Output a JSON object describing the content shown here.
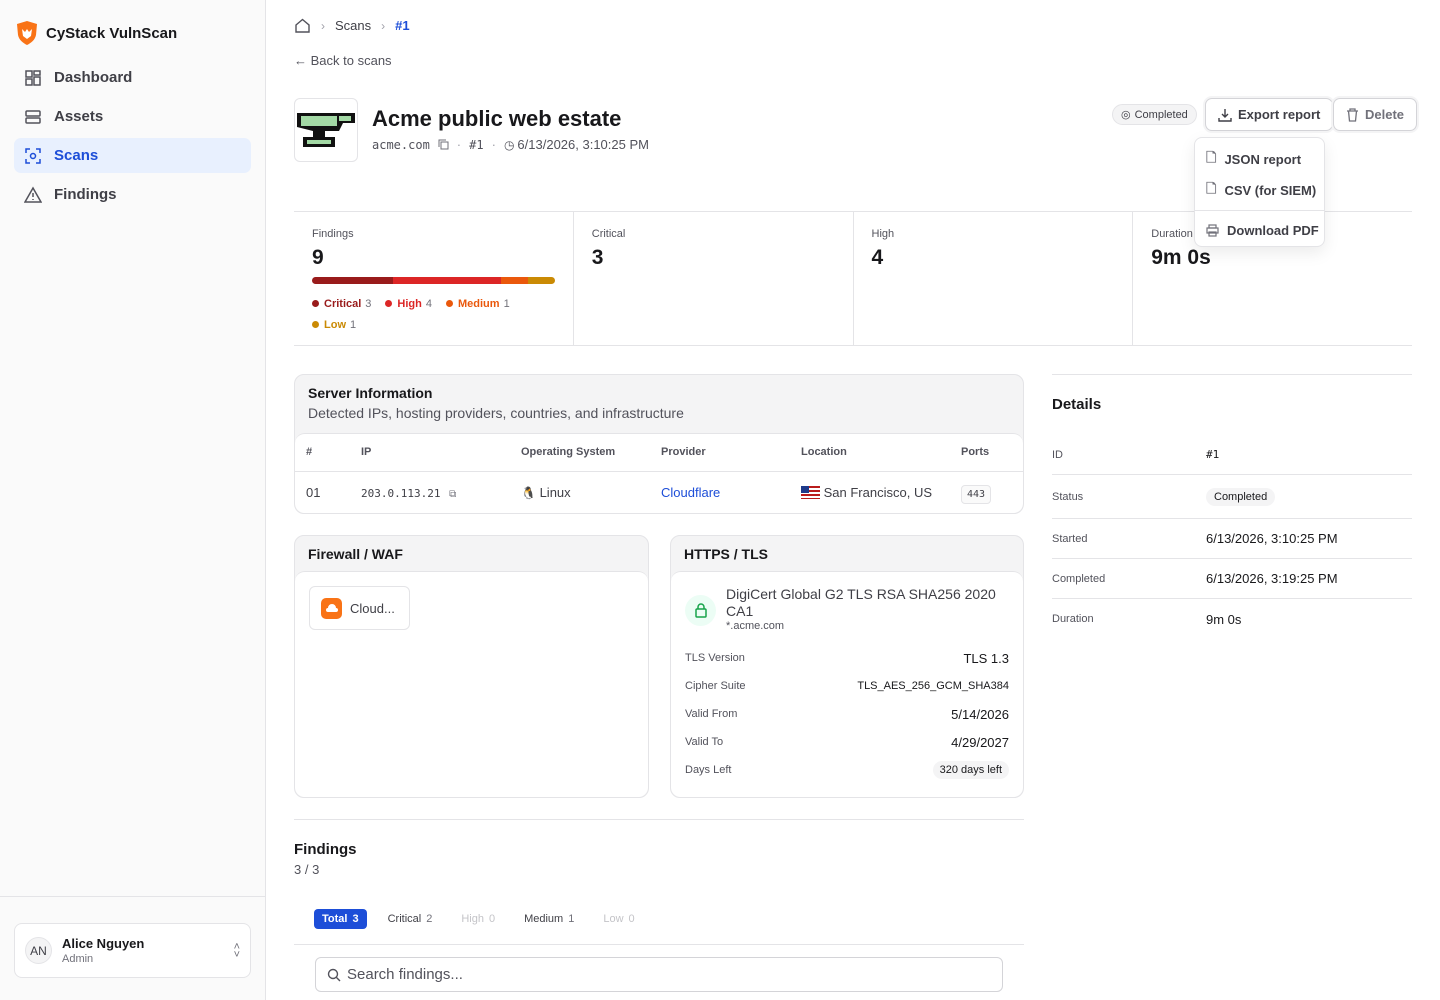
{
  "app": {
    "name": "CyStack VulnScan"
  },
  "sidebar": {
    "items": [
      {
        "label": "Dashboard",
        "icon": "dashboard-icon"
      },
      {
        "label": "Assets",
        "icon": "server-icon"
      },
      {
        "label": "Scans",
        "icon": "scan-icon",
        "active": true
      },
      {
        "label": "Findings",
        "icon": "warning-icon"
      }
    ],
    "user": {
      "initials": "AN",
      "name": "Alice Nguyen",
      "role": "Admin"
    }
  },
  "breadcrumb": {
    "items": [
      "Scans",
      "#1"
    ]
  },
  "back_label": "Back to scans",
  "scan": {
    "title": "Acme public web estate",
    "domain": "acme.com",
    "id": "#1",
    "started": "6/13/2026, 3:10:25 PM",
    "status": "Completed"
  },
  "actions": {
    "export_label": "Export report",
    "delete_label": "Delete",
    "export_menu": [
      "JSON report",
      "CSV (for SIEM)",
      "Download PDF"
    ]
  },
  "stats": {
    "findings": {
      "label": "Findings",
      "value": "9"
    },
    "critical": {
      "label": "Critical",
      "value": "3"
    },
    "high": {
      "label": "High",
      "value": "4"
    },
    "duration": {
      "label": "Duration",
      "value": "9m 0s"
    },
    "severity_breakdown": [
      {
        "label": "Critical",
        "count": 3,
        "color": "#991b1b"
      },
      {
        "label": "High",
        "count": 4,
        "color": "#dc2626"
      },
      {
        "label": "Medium",
        "count": 1,
        "color": "#ea580c"
      },
      {
        "label": "Low",
        "count": 1,
        "color": "#ca8a04"
      }
    ]
  },
  "server_info": {
    "title": "Server Information",
    "subtitle": "Detected IPs, hosting providers, countries, and infrastructure",
    "columns": [
      "#",
      "IP",
      "Operating System",
      "Provider",
      "Location",
      "Ports"
    ],
    "rows": [
      {
        "num": "01",
        "ip": "203.0.113.21",
        "os": "Linux",
        "provider": "Cloudflare",
        "location": "San Francisco, US",
        "ports": "443"
      }
    ]
  },
  "firewall": {
    "title": "Firewall / WAF",
    "item": "Cloud..."
  },
  "tls": {
    "title": "HTTPS / TLS",
    "cert_name": "DigiCert Global G2 TLS RSA SHA256 2020 CA1",
    "cert_domain": "*.acme.com",
    "rows": [
      {
        "label": "TLS Version",
        "value": "TLS 1.3"
      },
      {
        "label": "Cipher Suite",
        "value": "TLS_AES_256_GCM_SHA384"
      },
      {
        "label": "Valid From",
        "value": "5/14/2026"
      },
      {
        "label": "Valid To",
        "value": "4/29/2027"
      },
      {
        "label": "Days Left",
        "value": "320 days left"
      }
    ]
  },
  "details": {
    "title": "Details",
    "rows": [
      {
        "label": "ID",
        "value": "#1"
      },
      {
        "label": "Status",
        "value": "Completed"
      },
      {
        "label": "Started",
        "value": "6/13/2026, 3:10:25 PM"
      },
      {
        "label": "Completed",
        "value": "6/13/2026, 3:19:25 PM"
      },
      {
        "label": "Duration",
        "value": "9m 0s"
      }
    ]
  },
  "findings_section": {
    "title": "Findings",
    "count": "3 / 3",
    "tabs": [
      {
        "label": "Total",
        "count": "3"
      },
      {
        "label": "Critical",
        "count": "2"
      },
      {
        "label": "High",
        "count": "0"
      },
      {
        "label": "Medium",
        "count": "1"
      },
      {
        "label": "Low",
        "count": "0"
      }
    ],
    "search_placeholder": "Search findings..."
  }
}
